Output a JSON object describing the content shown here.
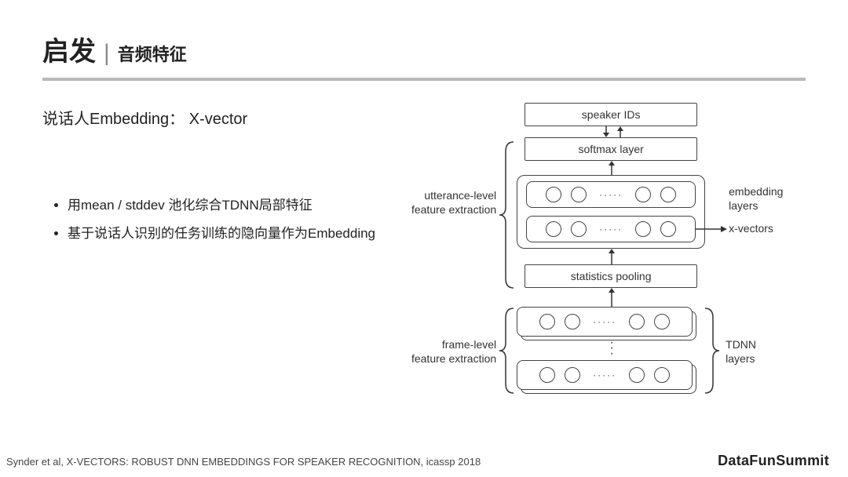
{
  "header": {
    "title_main": "启发",
    "title_sep": "|",
    "title_sub": "音频特征"
  },
  "subtitle": "说话人Embedding： X-vector",
  "bullets": [
    "用mean / stddev 池化综合TDNN局部特征",
    "基于说话人识别的任务训练的隐向量作为Embedding"
  ],
  "diagram": {
    "speaker_ids": "speaker IDs",
    "softmax": "softmax layer",
    "utterance_label_l1": "utterance-level",
    "utterance_label_l2": "feature extraction",
    "embedding_label_l1": "embedding",
    "embedding_label_l2": "layers",
    "xvectors": "x-vectors",
    "stats_pooling": "statistics pooling",
    "frame_label_l1": "frame-level",
    "frame_label_l2": "feature extraction",
    "tdnn_label_l1": "TDNN",
    "tdnn_label_l2": "layers"
  },
  "footer": "Synder et al, X-VECTORS: ROBUST DNN EMBEDDINGS FOR SPEAKER RECOGNITION, icassp 2018",
  "brand": "DataFunSummit"
}
